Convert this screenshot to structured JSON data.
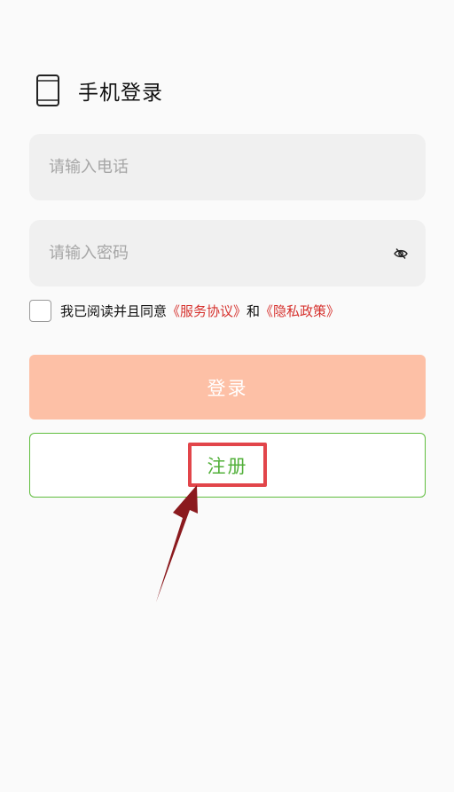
{
  "header": {
    "title": "手机登录",
    "icon": "phone-icon"
  },
  "phone": {
    "placeholder": "请输入电话"
  },
  "password": {
    "placeholder": "请输入密码",
    "toggle_icon": "eye-slash-icon"
  },
  "agreement": {
    "prefix": "我已阅读并且同意",
    "service_link": "《服务协议》",
    "and": "和",
    "privacy_link": "《隐私政策》"
  },
  "buttons": {
    "login": "登录",
    "register": "注册"
  },
  "colors": {
    "login_bg": "#fdc0a6",
    "register_accent": "#52b03a",
    "link": "#d6322e",
    "highlight": "#e2454a",
    "arrow": "#8b1a1e"
  }
}
